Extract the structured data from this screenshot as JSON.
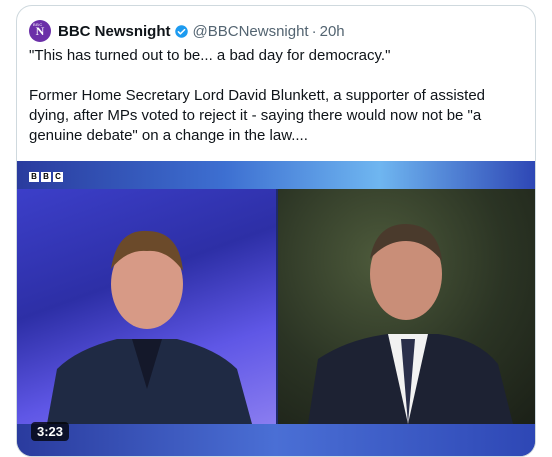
{
  "tweet": {
    "author_name": "BBC Newsnight",
    "handle": "@BBCNewsnight",
    "separator": "·",
    "time": "20h",
    "text": "\"This has turned out to be... a bad day for democracy.\"\n\nFormer Home Secretary Lord David Blunkett, a supporter of assisted dying, after MPs voted to reject it - saying there would now not be \"a genuine debate\" on a change in the law....",
    "avatar_icon": "bbc-newsnight-logo",
    "avatar_letter": "N",
    "avatar_strip": "BBC",
    "verified_icon": "verified-badge-icon"
  },
  "media": {
    "channel_logo": [
      "B",
      "B",
      "C"
    ],
    "duration": "3:23"
  },
  "colors": {
    "text_primary": "#0f1419",
    "text_secondary": "#536471",
    "verified_blue": "#1d9bf0",
    "border": "#cfd9de"
  }
}
